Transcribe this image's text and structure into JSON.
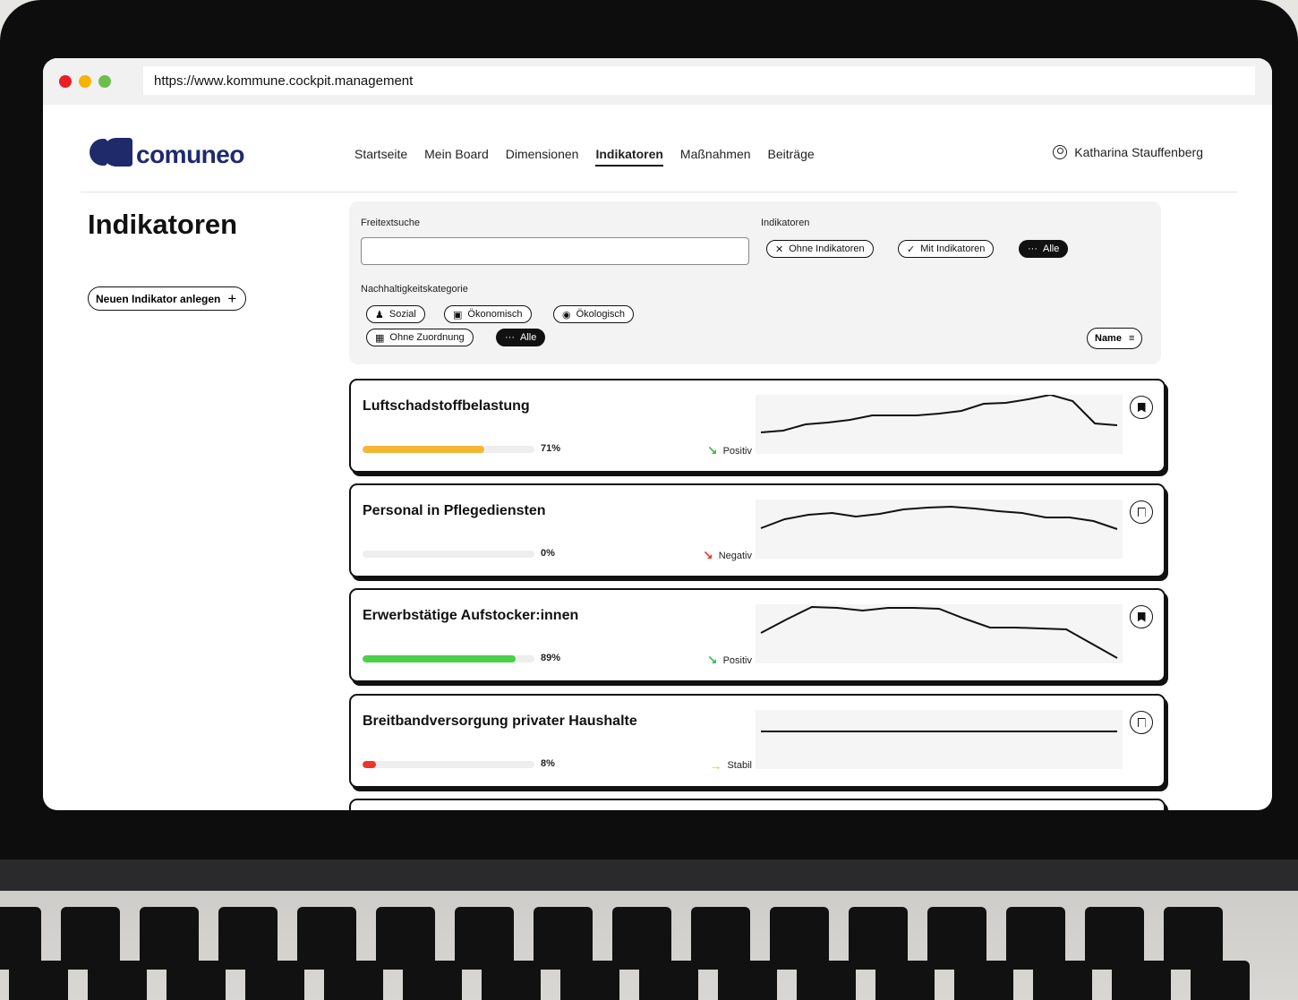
{
  "browser": {
    "url": "https://www.kommune.cockpit.management"
  },
  "header": {
    "logo_text": "comuneo",
    "nav": [
      "Startseite",
      "Mein Board",
      "Dimensionen",
      "Indikatoren",
      "Maßnahmen",
      "Beiträge"
    ],
    "active_nav": "Indikatoren",
    "user_name": "Katharina Stauffenberg"
  },
  "sidebar": {
    "title": "Indikatoren",
    "new_button": "Neuen Indikator anlegen"
  },
  "filters": {
    "search_label": "Freitextsuche",
    "search_value": "",
    "indicator_label": "Indikatoren",
    "indicator_chips": [
      "Ohne Indikatoren",
      "Mit Indikatoren",
      "Alle"
    ],
    "category_label": "Nachhaltigkeitskategorie",
    "category_chips": [
      "Sozial",
      "Ökonomisch",
      "Ökologisch",
      "Ohne Zuordnung",
      "Alle"
    ],
    "sort_label": "Name"
  },
  "indicators": [
    {
      "title": "Luftschadstoffbelastung",
      "progress": 71,
      "progress_label": "71%",
      "bar_color": "#f3b734",
      "trend": "Positiv",
      "trend_color": "#3fb54a",
      "bookmarked": true,
      "series": [
        20,
        22,
        29,
        31,
        34,
        39,
        39,
        39,
        41,
        44,
        52,
        53,
        57,
        62,
        55,
        30,
        28
      ]
    },
    {
      "title": "Personal in Pflegediensten",
      "progress": 0,
      "progress_label": "0%",
      "bar_color": "#cccccc",
      "trend": "Negativ",
      "trend_color": "#e8382b",
      "bookmarked": false,
      "series": [
        30,
        40,
        45,
        47,
        43,
        46,
        51,
        53,
        54,
        52,
        49,
        47,
        42,
        42,
        38,
        29
      ]
    },
    {
      "title": "Erwerbstätige Aufstocker:innen",
      "progress": 89,
      "progress_label": "89%",
      "bar_color": "#4ccf4a",
      "trend": "Positiv",
      "trend_color": "#3fb54a",
      "bookmarked": true,
      "series": [
        30,
        45,
        59,
        58,
        55,
        58,
        58,
        57,
        46,
        36,
        36,
        35,
        34,
        18,
        2
      ]
    },
    {
      "title": "Breitbandversorgung privater Haushalte",
      "progress": 8,
      "progress_label": "8%",
      "bar_color": "#e8382b",
      "trend": "Stabil",
      "trend_color": "#f3b734",
      "bookmarked": false,
      "series": [
        38,
        38,
        38,
        38,
        38,
        38,
        38,
        38,
        38,
        38,
        38,
        38,
        38,
        38,
        38,
        38
      ]
    }
  ]
}
